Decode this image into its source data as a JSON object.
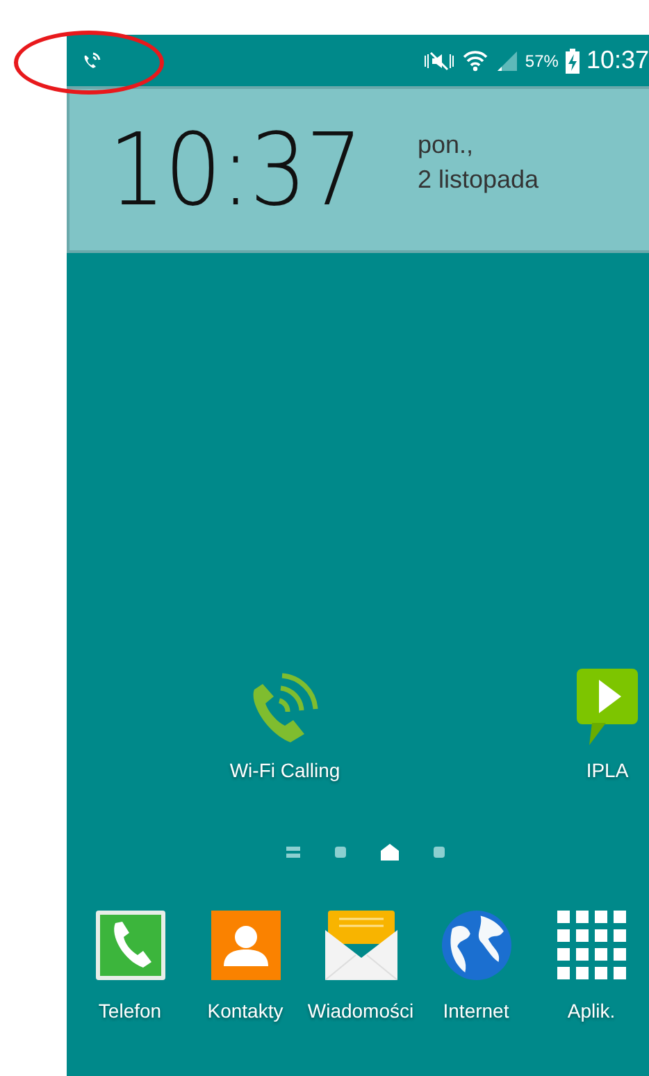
{
  "status_bar": {
    "battery": "57%",
    "time": "10:37"
  },
  "clock_widget": {
    "time": "10:37",
    "day": "pon.,",
    "date": "2 listopada"
  },
  "home_apps": [
    {
      "kind": "wifi-calling",
      "label": "Wi-Fi Calling"
    },
    {
      "kind": "ipla",
      "label": "IPLA"
    }
  ],
  "page_indicator": [
    {
      "kind": "list",
      "selected": false
    },
    {
      "kind": "page",
      "selected": false
    },
    {
      "kind": "home",
      "selected": true
    },
    {
      "kind": "page",
      "selected": false
    }
  ],
  "dock": [
    {
      "kind": "phone",
      "label": "Telefon"
    },
    {
      "kind": "contacts",
      "label": "Kontakty"
    },
    {
      "kind": "messages",
      "label": "Wiadomości"
    },
    {
      "kind": "internet",
      "label": "Internet"
    },
    {
      "kind": "apps",
      "label": "Aplik."
    }
  ]
}
